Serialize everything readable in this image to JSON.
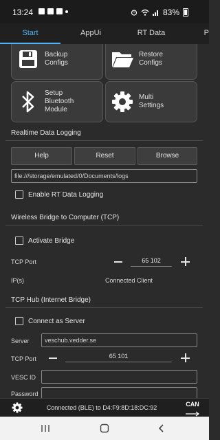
{
  "status_bar": {
    "time": "13:24",
    "battery": "83%"
  },
  "tabs": [
    {
      "label": "Start",
      "active": true
    },
    {
      "label": "AppUi",
      "active": false
    },
    {
      "label": "RT Data",
      "active": false
    },
    {
      "label": "P",
      "active": false
    }
  ],
  "tiles": {
    "backup": "Backup\nConfigs",
    "restore": "Restore\nConfigs",
    "bluetooth": "Setup\nBluetooth\nModule",
    "multi": "Multi\nSettings"
  },
  "realtime_logging": {
    "title": "Realtime Data Logging",
    "help": "Help",
    "reset": "Reset",
    "browse": "Browse",
    "path": "file:///storage/emulated/0/Documents/logs",
    "enable_label": "Enable RT Data Logging"
  },
  "wireless_bridge": {
    "title": "Wireless Bridge to Computer (TCP)",
    "activate_label": "Activate Bridge",
    "tcp_port_label": "TCP Port",
    "tcp_port_value": "65 102",
    "ips_label": "IP(s)",
    "client_label": "Connected Client"
  },
  "tcp_hub": {
    "title": "TCP Hub (Internet Bridge)",
    "connect_label": "Connect as Server",
    "server_label": "Server",
    "server_value": "veschub.vedder.se",
    "tcp_port_label": "TCP Port",
    "tcp_port_value": "65 101",
    "vesc_id_label": "VESC ID",
    "password_label": "Password"
  },
  "bottom_bar": {
    "connection": "Connected (BLE) to D4:F9:8D:18:DC:92",
    "can_label": "CAN"
  },
  "colors": {
    "accent": "#4fb3f5",
    "background": "#2b2b2b"
  }
}
